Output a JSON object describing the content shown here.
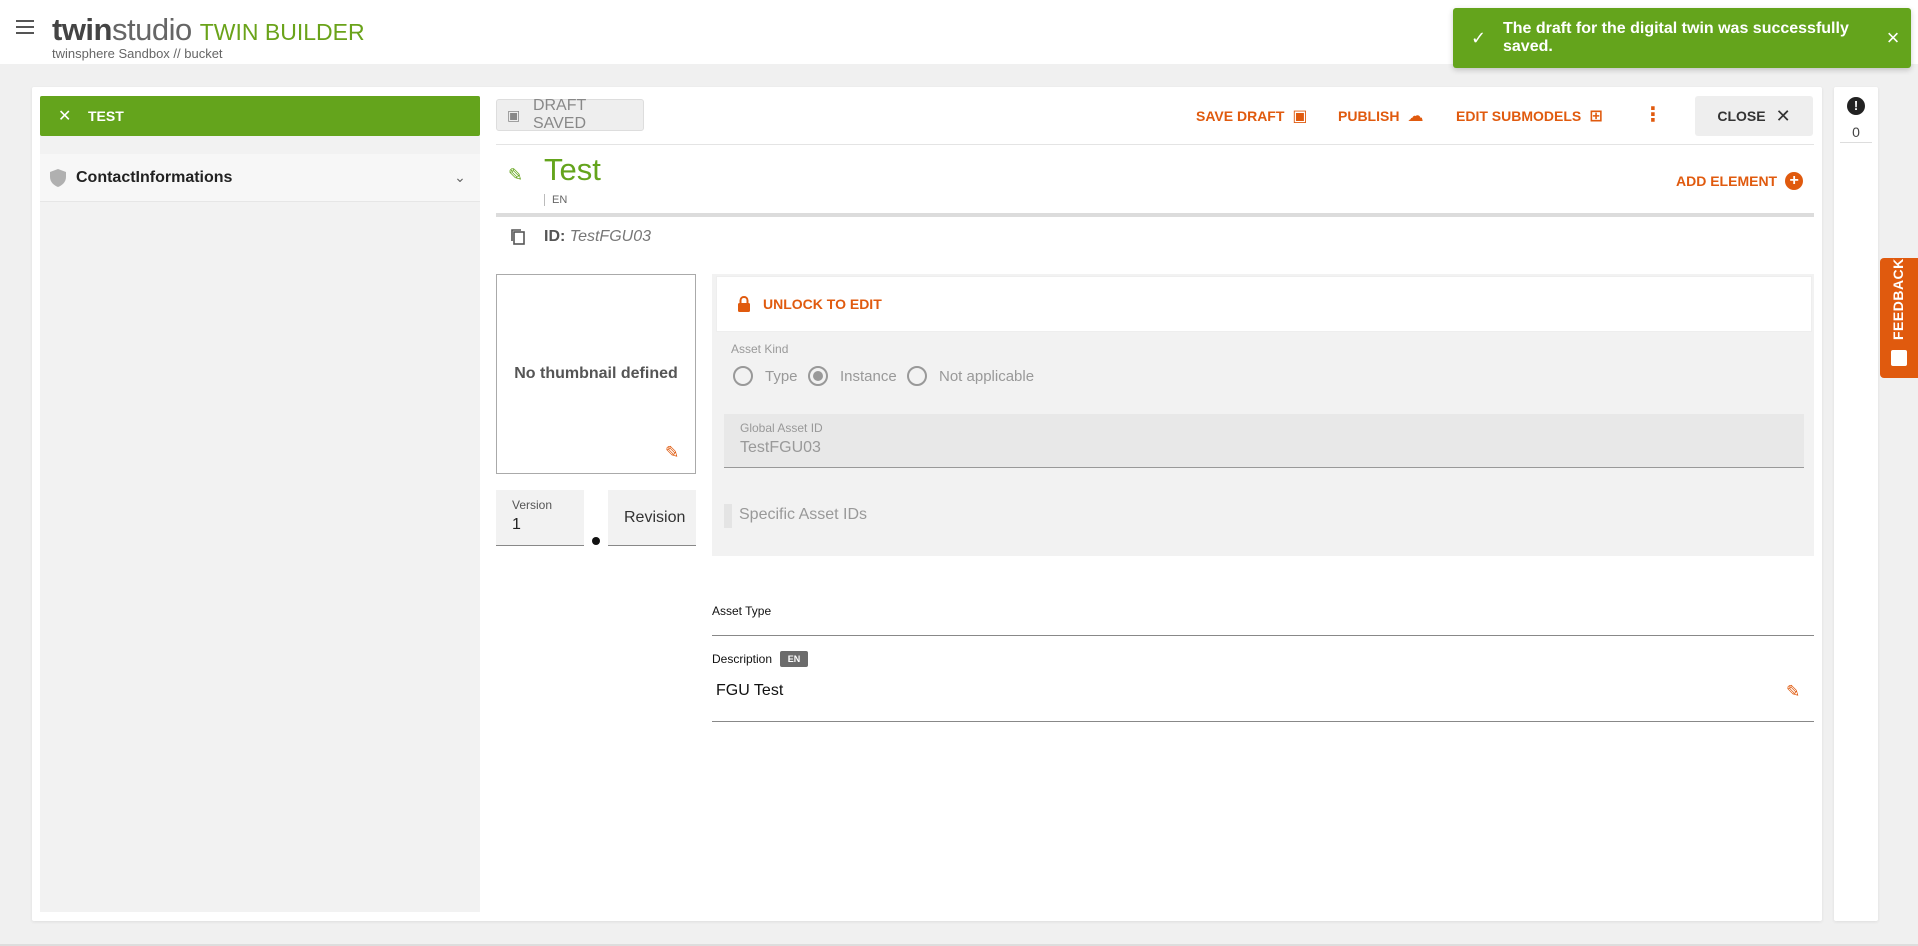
{
  "header": {
    "brand_twin": "twin",
    "brand_studio": "studio",
    "product": "TWIN BUILDER",
    "breadcrumb": "twinsphere Sandbox // bucket"
  },
  "toast": {
    "message": "The draft for the digital twin was successfully saved."
  },
  "tree": {
    "root_label": "TEST",
    "items": [
      {
        "label": "ContactInformations"
      }
    ]
  },
  "toolbar": {
    "draft_status": "DRAFT SAVED",
    "save_draft": "SAVE DRAFT",
    "publish": "PUBLISH",
    "edit_submodels": "EDIT SUBMODELS",
    "close": "CLOSE"
  },
  "twin": {
    "title": "Test",
    "title_lang": "EN",
    "add_element": "ADD ELEMENT",
    "id_label": "ID:",
    "id_value": "TestFGU03"
  },
  "thumbnail": {
    "placeholder": "No thumbnail defined"
  },
  "version": {
    "version_label": "Version",
    "version_value": "1",
    "revision_label": "Revision"
  },
  "asset": {
    "unlock_label": "UNLOCK TO EDIT",
    "kind_label": "Asset Kind",
    "kind_options": [
      "Type",
      "Instance",
      "Not applicable"
    ],
    "kind_selected": "Instance",
    "global_id_label": "Global Asset ID",
    "global_id_value": "TestFGU03",
    "specific_ids_label": "Specific Asset IDs",
    "asset_type_label": "Asset Type",
    "description_label": "Description",
    "description_lang": "EN",
    "description_value": "FGU Test"
  },
  "sidebar_right": {
    "alert_count": "0"
  },
  "feedback": {
    "label": "FEEDBACK"
  },
  "colors": {
    "brand_green": "#64a41c",
    "accent_orange": "#e05a0e"
  }
}
